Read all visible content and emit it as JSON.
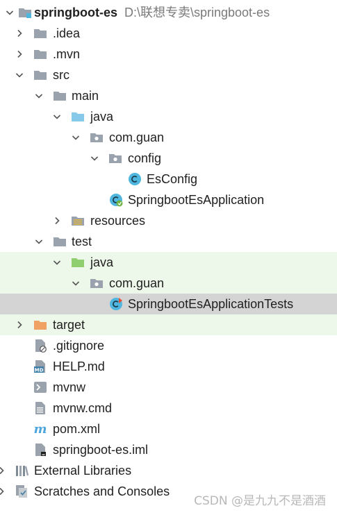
{
  "project": {
    "name": "springboot-es",
    "path": "D:\\联想专卖\\springboot-es"
  },
  "tree": {
    "idea": ".idea",
    "mvn": ".mvn",
    "src": "src",
    "main": "main",
    "main_java": "java",
    "main_pkg": "com.guan",
    "config": "config",
    "esconfig": "EsConfig",
    "app": "SpringbootEsApplication",
    "resources": "resources",
    "test": "test",
    "test_java": "java",
    "test_pkg": "com.guan",
    "app_tests": "SpringbootEsApplicationTests",
    "target": "target",
    "gitignore": ".gitignore",
    "help": "HELP.md",
    "mvnw": "mvnw",
    "mvnw_cmd": "mvnw.cmd",
    "pom": "pom.xml",
    "iml": "springboot-es.iml",
    "external_libraries": "External Libraries",
    "scratches": "Scratches and Consoles"
  },
  "icons": {
    "folder": "#9aa3ad",
    "source_folder": "#87c9e8",
    "test_folder": "#8fcf70",
    "excluded_folder": "#f0a265",
    "class": "#4fb6df",
    "spring": "#6db33f"
  },
  "watermark": "CSDN @是九九不是酒酒"
}
